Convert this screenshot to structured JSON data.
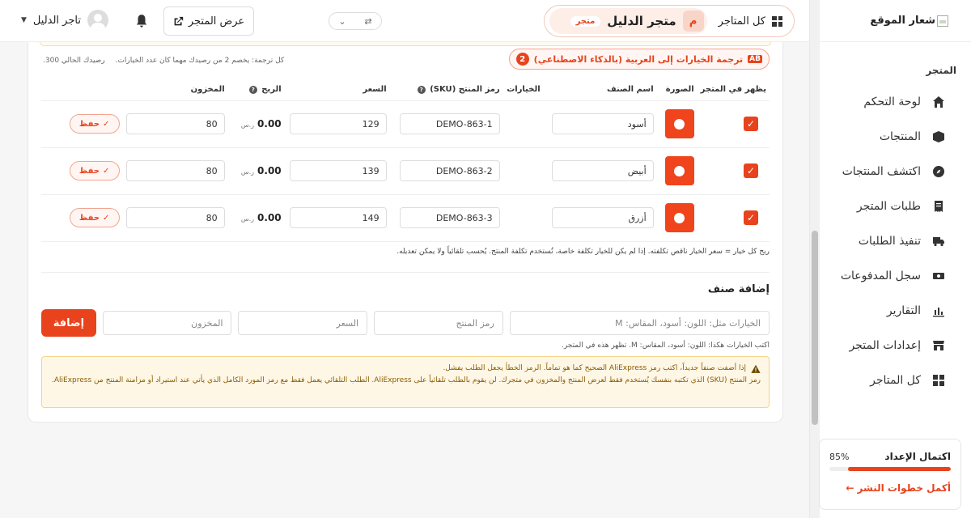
{
  "sidebar": {
    "logo_text": "شعار الموقع",
    "section_title": "المتجر",
    "items": [
      {
        "label": "لوحة التحكم",
        "icon": "home-icon"
      },
      {
        "label": "المنتجات",
        "icon": "box-icon"
      },
      {
        "label": "اكتشف المنتجات",
        "icon": "compass-icon"
      },
      {
        "label": "طلبات المتجر",
        "icon": "receipt-icon"
      },
      {
        "label": "تنفيذ الطلبات",
        "icon": "truck-icon"
      },
      {
        "label": "سجل المدفوعات",
        "icon": "money-icon"
      },
      {
        "label": "التقارير",
        "icon": "chart-icon"
      },
      {
        "label": "إعدادات المتجر",
        "icon": "store-icon"
      },
      {
        "label": "كل المتاجر",
        "icon": "grid-icon"
      }
    ],
    "setup": {
      "title": "اكتمال الإعداد",
      "percent_label": "85%",
      "percent": 85,
      "link": "أكمل خطوات النشر ←"
    }
  },
  "header": {
    "all_stores": "كل المتاجر",
    "store_avatar": "م",
    "store_name": "متجر الدليل",
    "store_tag": "متجر",
    "view_store": "عرض المتجر",
    "user_name": "تاجر الدليل"
  },
  "variants": {
    "ai_button": "ترجمة الخيارات إلى العربية (بالذكاء الاصطناعي)",
    "ai_count": "2",
    "credits_note": "كل ترجمة: يخصم 2 من رصيدك مهما كان عدد الخيارات.",
    "credits_balance": "رصيدك الحالي 300.",
    "columns": [
      "يظهر في المتجر",
      "الصورة",
      "اسم الصنف",
      "الخيارات",
      "رمز المنتج (SKU)",
      "السعر",
      "الربح",
      "المخزون"
    ],
    "currency": "ر.س",
    "save_label": "حفظ",
    "rows": [
      {
        "name": "أسود",
        "sku": "DEMO-863-1",
        "price": "129",
        "profit": "0.00",
        "stock": "80"
      },
      {
        "name": "أبيض",
        "sku": "DEMO-863-2",
        "price": "139",
        "profit": "0.00",
        "stock": "80"
      },
      {
        "name": "أزرق",
        "sku": "DEMO-863-3",
        "price": "149",
        "profit": "0.00",
        "stock": "80"
      }
    ],
    "profit_note": "ربح كل خيار = سعر الخيار ناقص تكلفته. إذا لم يكن للخيار تكلفة خاصة، تُستخدم تكلفة المنتج. يُحسب تلقائياً ولا يمكن تعديله."
  },
  "add_variant": {
    "title": "إضافة صنف",
    "options_placeholder": "الخيارات مثل: اللون: أسود، المقاس: M",
    "sku_placeholder": "رمز المنتج",
    "price_placeholder": "السعر",
    "stock_placeholder": "المخزون",
    "add_button": "إضافة",
    "hint": "اكتب الخيارات هكذا: اللون: أسود، المقاس: M. تظهر هذه في المتجر.",
    "warning_line1": "إذا أضفت صنفاً جديداً، اكتب رمز AliExpress الصحيح كما هو تماماً. الرمز الخطأ يجعل الطلب يفشل.",
    "warning_line2": "رمز المنتج (SKU) الذي تكتبه بنفسك يُستخدم فقط لعرض المنتج والمخزون في متجرك. لن يقوم بالطلب تلقائياً على AliExpress. الطلب التلقائي يعمل فقط مع رمز المورد الكامل الذي يأتي عند استيراد أو مزامنة المنتج من AliExpress."
  },
  "colors": {
    "accent": "#e8431d",
    "accent_soft": "#fdeee8",
    "warning_bg": "#fff7e6"
  }
}
